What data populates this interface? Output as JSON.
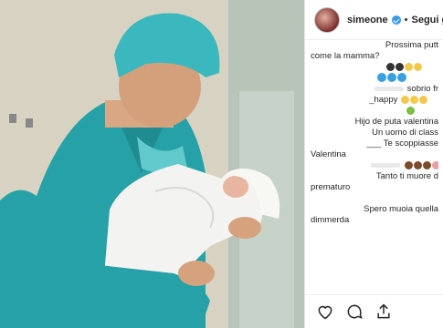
{
  "post": {
    "username": "simeone",
    "follow_label": "Segui gi",
    "comments": [
      "Prossima putt",
      "come la mamma?",
      "",
      "",
      "sobrio fr",
      "_happy",
      "",
      "Hijo de puta valentina",
      "Un uomo di class",
      "___ Te scoppiasse",
      "Valentina",
      "",
      "Tanto ti muore d",
      "prematuro",
      "",
      "Spero muoia quella",
      "dimmerda"
    ]
  },
  "icons": [
    "heart-icon",
    "comment-icon",
    "share-icon"
  ],
  "colors": {
    "scrubs": "#27a1a8",
    "verified": "#3897f0"
  }
}
